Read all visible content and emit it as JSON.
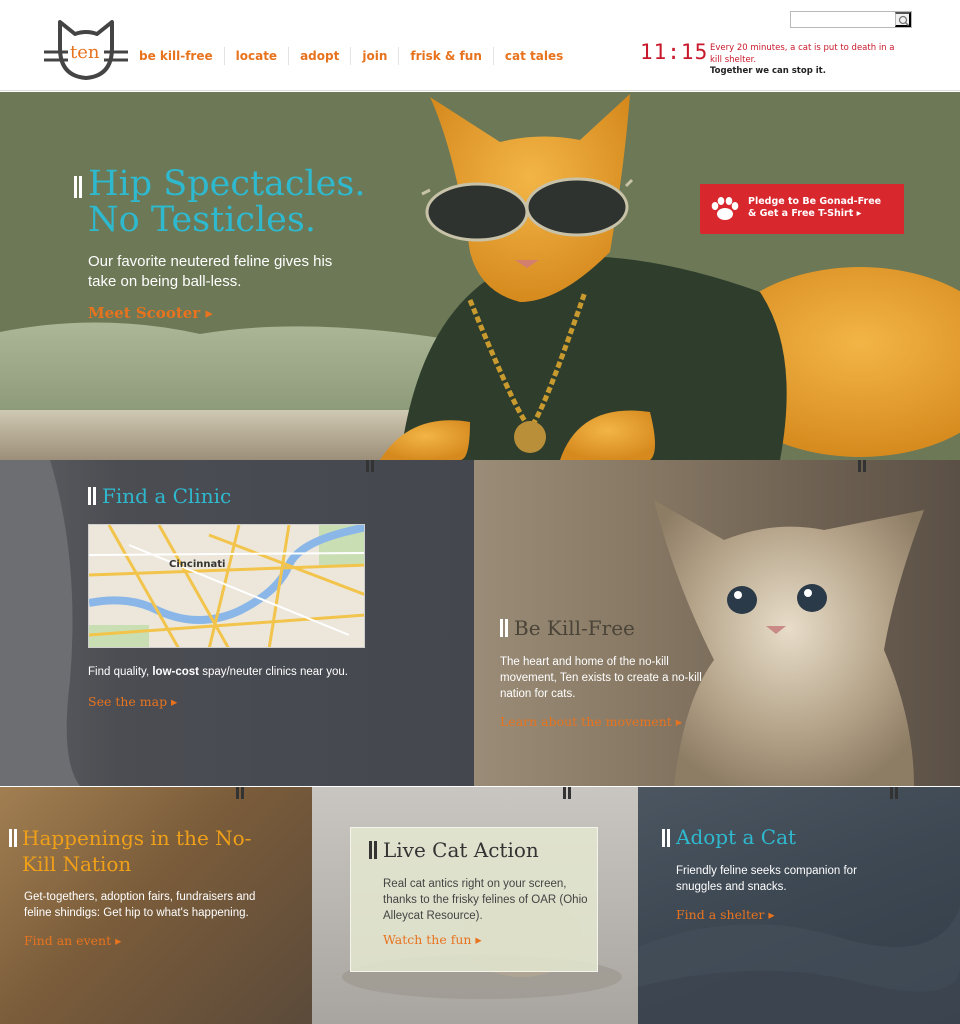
{
  "header": {
    "logo_text": "ten",
    "nav": [
      "be kill-free",
      "locate",
      "adopt",
      "join",
      "frisk & fun",
      "cat tales"
    ],
    "search_placeholder": "",
    "clock": "11:15",
    "stat_line": "Every 20 minutes, a cat is put to death in a kill shelter.",
    "stat_tagline": "Together we can stop it."
  },
  "hero": {
    "title_line1": "Hip Spectacles.",
    "title_line2": "No Testicles.",
    "description": "Our favorite neutered feline gives his take on being ball-less.",
    "cta": "Meet Scooter ▸",
    "pledge_line1": "Pledge to Be Gonad-Free",
    "pledge_line2": "& Get a Free T-Shirt ▸"
  },
  "panels": {
    "clinic": {
      "title": "Find a Clinic",
      "map_city": "Cincinnati",
      "text_before": "Find quality, ",
      "text_bold": "low-cost",
      "text_after": " spay/neuter clinics near you.",
      "cta": "See the map ▸"
    },
    "killfree": {
      "title": "Be Kill-Free",
      "text": "The heart and home of the no-kill movement, Ten exists to create a no-kill nation for cats.",
      "cta": "Learn about the movement ▸"
    },
    "happenings": {
      "title": "Happenings in the No-Kill Nation",
      "text": "Get-togethers, adoption fairs, fundraisers and feline shindigs: Get hip to what's happening.",
      "cta": "Find an event ▸"
    },
    "live": {
      "title": "Live Cat Action",
      "text": "Real cat antics right on your screen, thanks to the frisky felines of OAR (Ohio Alleycat Resource).",
      "cta": "Watch the fun ▸"
    },
    "adopt": {
      "title": "Adopt a Cat",
      "text": "Friendly feline seeks companion for snuggles and snacks.",
      "cta": "Find a shelter ▸"
    }
  },
  "colors": {
    "accent_orange": "#e8731e",
    "accent_teal": "#2fb9cf",
    "alert_red": "#c8192c",
    "pledge_red": "#d8272d"
  },
  "icons": [
    "cat-logo-icon",
    "search-icon",
    "paw-icon"
  ]
}
